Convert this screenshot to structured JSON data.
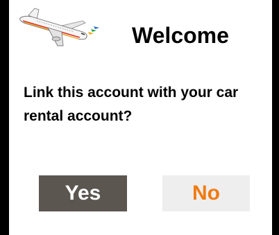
{
  "dialog": {
    "title": "Welcome",
    "question": "Link this account with your car rental account?",
    "buttons": {
      "yes_label": "Yes",
      "no_label": "No"
    },
    "icon": "airplane-icon"
  },
  "colors": {
    "background": "#000000",
    "panel": "#ffffff",
    "yes_bg": "#5b5650",
    "yes_text": "#ffffff",
    "no_bg": "#eeeeee",
    "no_text": "#f07b12"
  }
}
